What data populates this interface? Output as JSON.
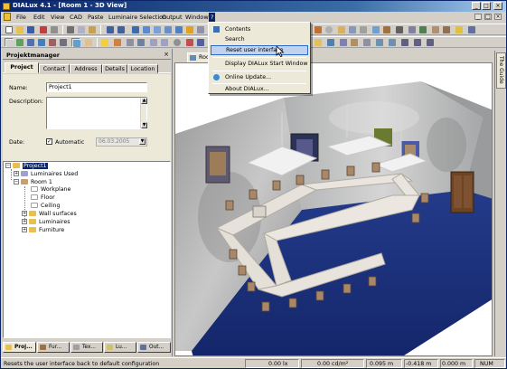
{
  "window": {
    "title": "DIALux 4.1 - [Room 1 - 3D View]",
    "controls": [
      "_",
      "□",
      "×"
    ]
  },
  "menubar": {
    "items": [
      "File",
      "Edit",
      "View",
      "CAD",
      "Paste",
      "Luminaire Selection",
      "Output",
      "Window",
      "?"
    ],
    "active_index": 8
  },
  "help_menu": {
    "items": [
      {
        "label": "Contents",
        "icon": "help-book-icon"
      },
      {
        "label": "Search",
        "icon": "none"
      },
      {
        "label": "Reset user interface",
        "icon": "none",
        "highlighted": true
      },
      {
        "label": "Display DIALux Start Window",
        "icon": "none"
      },
      {
        "label": "Online Update...",
        "icon": "globe-icon"
      },
      {
        "label": "About DIALux...",
        "icon": "none"
      }
    ]
  },
  "project_manager": {
    "title": "Projektmanager",
    "tabs": [
      "Project",
      "Contact",
      "Address",
      "Details",
      "Location"
    ],
    "active_tab": 0,
    "form": {
      "name_label": "Name:",
      "name_value": "Project1",
      "description_label": "Description:",
      "description_value": "",
      "date_label": "Date:",
      "automatic_label": "Automatic",
      "automatic_checked": true,
      "date_value": "06.03.2005"
    },
    "tree": {
      "project": "Project1",
      "luminaires_used": "Luminaires Used",
      "room": "Room 1",
      "children": [
        "Workplane",
        "Floor",
        "Ceiling",
        "Wall surfaces",
        "Luminaires",
        "Furniture"
      ]
    },
    "bottom_tabs": [
      "Proj...",
      "Fur...",
      "Tex...",
      "Lu...",
      "Out..."
    ]
  },
  "view_tab": {
    "label": "Roo"
  },
  "guide": {
    "label": "The Guide"
  },
  "statusbar": {
    "message": "Resets the user interface back to default configuration",
    "illuminance": "0.00 lx",
    "luminance": "0.00 cd/m²",
    "coord1": "0.095 m",
    "coord2": "-0.418 m",
    "coord3": "0.000 m",
    "mode": "NUM"
  },
  "colors": {
    "titlebar": "#0a246a",
    "menu_highlight": "#c1d2ee",
    "floor": "#1c2f78",
    "wall": "#a7a8a9",
    "table": "#e8e4dc"
  }
}
